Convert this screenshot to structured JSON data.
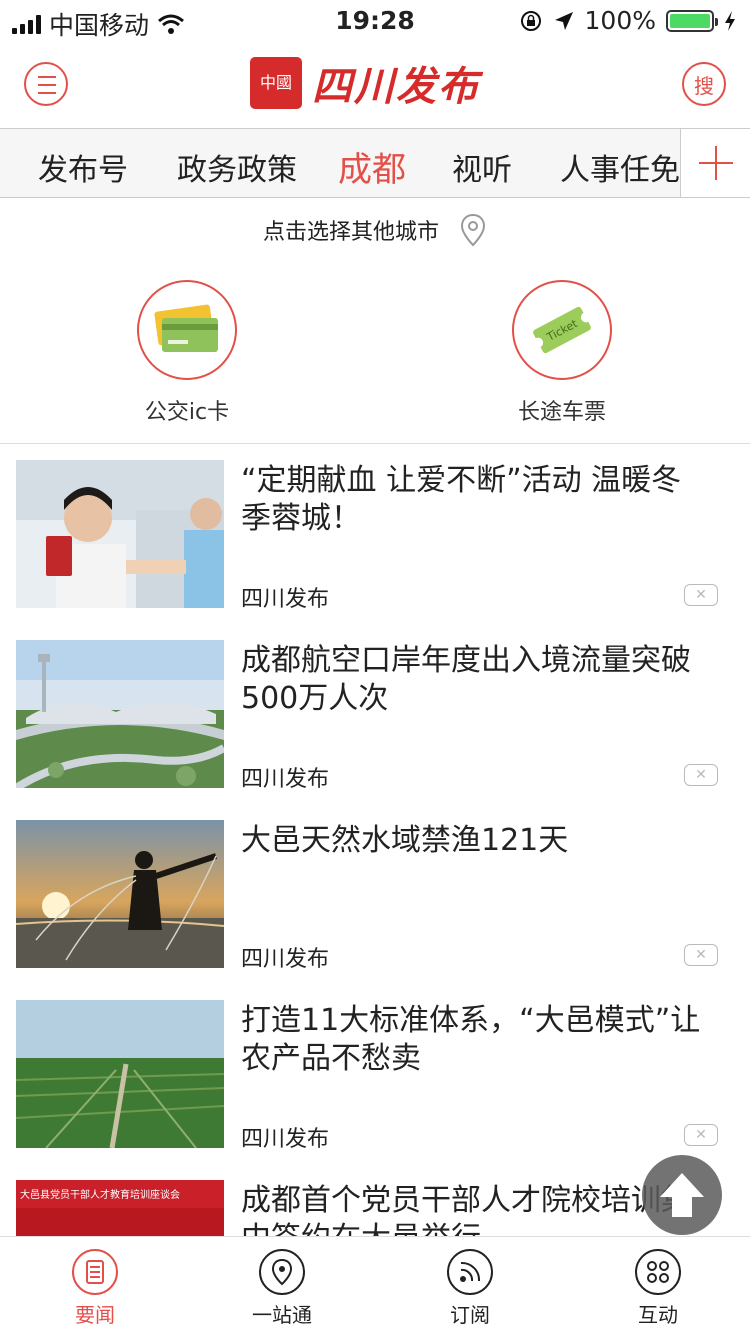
{
  "status_bar": {
    "carrier": "中国移动",
    "time": "19:28",
    "battery_text": "100%",
    "battery_level": 1.0
  },
  "header": {
    "logo_seal": "中國",
    "logo_text": "四川发布",
    "search_label": "搜"
  },
  "tabs": [
    {
      "label": "发布号"
    },
    {
      "label": "政务政策"
    },
    {
      "label": "成都"
    },
    {
      "label": "视听"
    },
    {
      "label": "人事任免"
    }
  ],
  "active_tab": "成都",
  "city_select": {
    "label": "点击选择其他城市"
  },
  "services": [
    {
      "label": "公交ic卡",
      "icon": "bus-card-icon"
    },
    {
      "label": "长途车票",
      "icon": "ticket-icon",
      "icon_text": "Ticket"
    }
  ],
  "news": [
    {
      "title": "“定期献血 让爱不断”活动 温暖冬季蓉城！",
      "source": "四川发布",
      "image": "blood-donation-photo"
    },
    {
      "title": "成都航空口岸年度出入境流量突破500万人次",
      "source": "四川发布",
      "image": "airport-photo"
    },
    {
      "title": "大邑天然水域禁渔121天",
      "source": "四川发布",
      "image": "fisherman-photo"
    },
    {
      "title": "打造11大标准体系，“大邑模式”让农产品不愁卖",
      "source": "四川发布",
      "image": "farmland-photo"
    },
    {
      "title": "成都首个党员干部人才院校培训集中签约在大邑举行",
      "source": "",
      "image": "conference-photo",
      "banner_text": "大邑县党员干部人才教育培训座谈会"
    }
  ],
  "bottom_nav": [
    {
      "label": "要闻",
      "icon": "news-icon",
      "active": true
    },
    {
      "label": "一站通",
      "icon": "location-icon",
      "active": false
    },
    {
      "label": "订阅",
      "icon": "rss-icon",
      "active": false
    },
    {
      "label": "互动",
      "icon": "grid-icon",
      "active": false
    }
  ],
  "colors": {
    "accent": "#e2504a",
    "brand_red": "#d62b2b"
  }
}
